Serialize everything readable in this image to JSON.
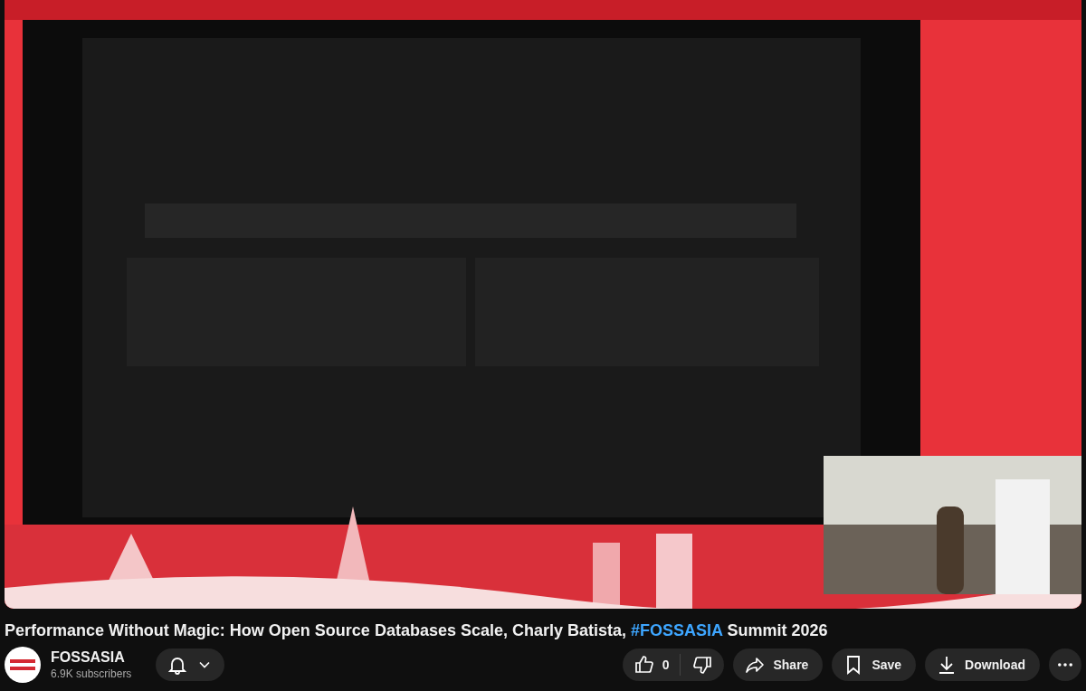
{
  "title": {
    "before": "Performance Without Magic: How Open Source Databases Scale, Charly Batista, ",
    "hashtag": "#FOSSASIA",
    "after": " Summit 2026"
  },
  "channel": {
    "name": "FOSSASIA",
    "subscribers": "6.9K subscribers"
  },
  "actions": [
    {
      "kind": "like",
      "label": "0"
    },
    {
      "kind": "share",
      "label": "Share"
    },
    {
      "kind": "save",
      "label": "Save"
    },
    {
      "kind": "download",
      "label": "Download"
    },
    {
      "kind": "more"
    }
  ]
}
